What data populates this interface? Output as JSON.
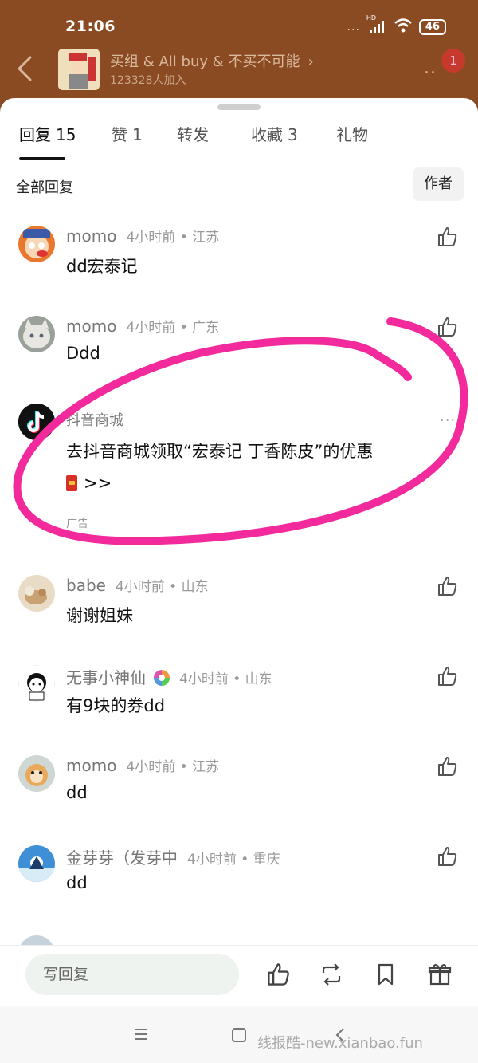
{
  "status_bar": {
    "time": "21:06",
    "more_dots": "...",
    "network": "HD",
    "battery": "46"
  },
  "header": {
    "group_name": "买组 & All buy & 不买不可能",
    "group_count": "123328人加入",
    "more_dots": "..",
    "notification_count": "1"
  },
  "tabs": [
    {
      "label": "回复",
      "count": "15",
      "active": true
    },
    {
      "label": "赞",
      "count": "1"
    },
    {
      "label": "转发",
      "count": ""
    },
    {
      "label": "收藏",
      "count": "3"
    },
    {
      "label": "礼物",
      "count": ""
    }
  ],
  "filter": {
    "label": "全部回复",
    "author_button": "作者"
  },
  "comments": [
    {
      "name": "momo",
      "time": "4小时前 • 江苏",
      "text": "dd宏泰记"
    },
    {
      "name": "momo",
      "time": "4小时前 • 广东",
      "text": "Ddd"
    },
    {
      "name": "babe",
      "time": "4小时前 • 山东",
      "text": "谢谢姐妹"
    },
    {
      "name": "无事小神仙",
      "time": "4小时前 • 山东",
      "text": "有9块的券dd"
    },
    {
      "name": "momo",
      "time": "4小时前 • 江苏",
      "text": "dd"
    },
    {
      "name": "金芽芽（发芽中",
      "time": "4小时前 • 重庆",
      "text": "dd"
    }
  ],
  "ad": {
    "name": "抖音商城",
    "text": "去抖音商城领取“宏泰记 丁香陈皮”的优惠",
    "link_suffix": ">>",
    "label": "广告",
    "more_dots": "..."
  },
  "bottom_bar": {
    "reply_placeholder": "写回复"
  },
  "watermark": "线报酷-new.xianbao.fun",
  "colors": {
    "header_bg": "#8a4a22",
    "annotation_stroke": "#f22a9c",
    "badge": "#c63a2e"
  },
  "icons": [
    "back-icon",
    "wifi-icon",
    "signal-icon",
    "thumbs-up-icon",
    "repost-icon",
    "bookmark-icon",
    "gift-icon",
    "menu-icon",
    "home-icon",
    "nav-back-icon",
    "douyin-logo-icon",
    "red-packet-icon"
  ]
}
